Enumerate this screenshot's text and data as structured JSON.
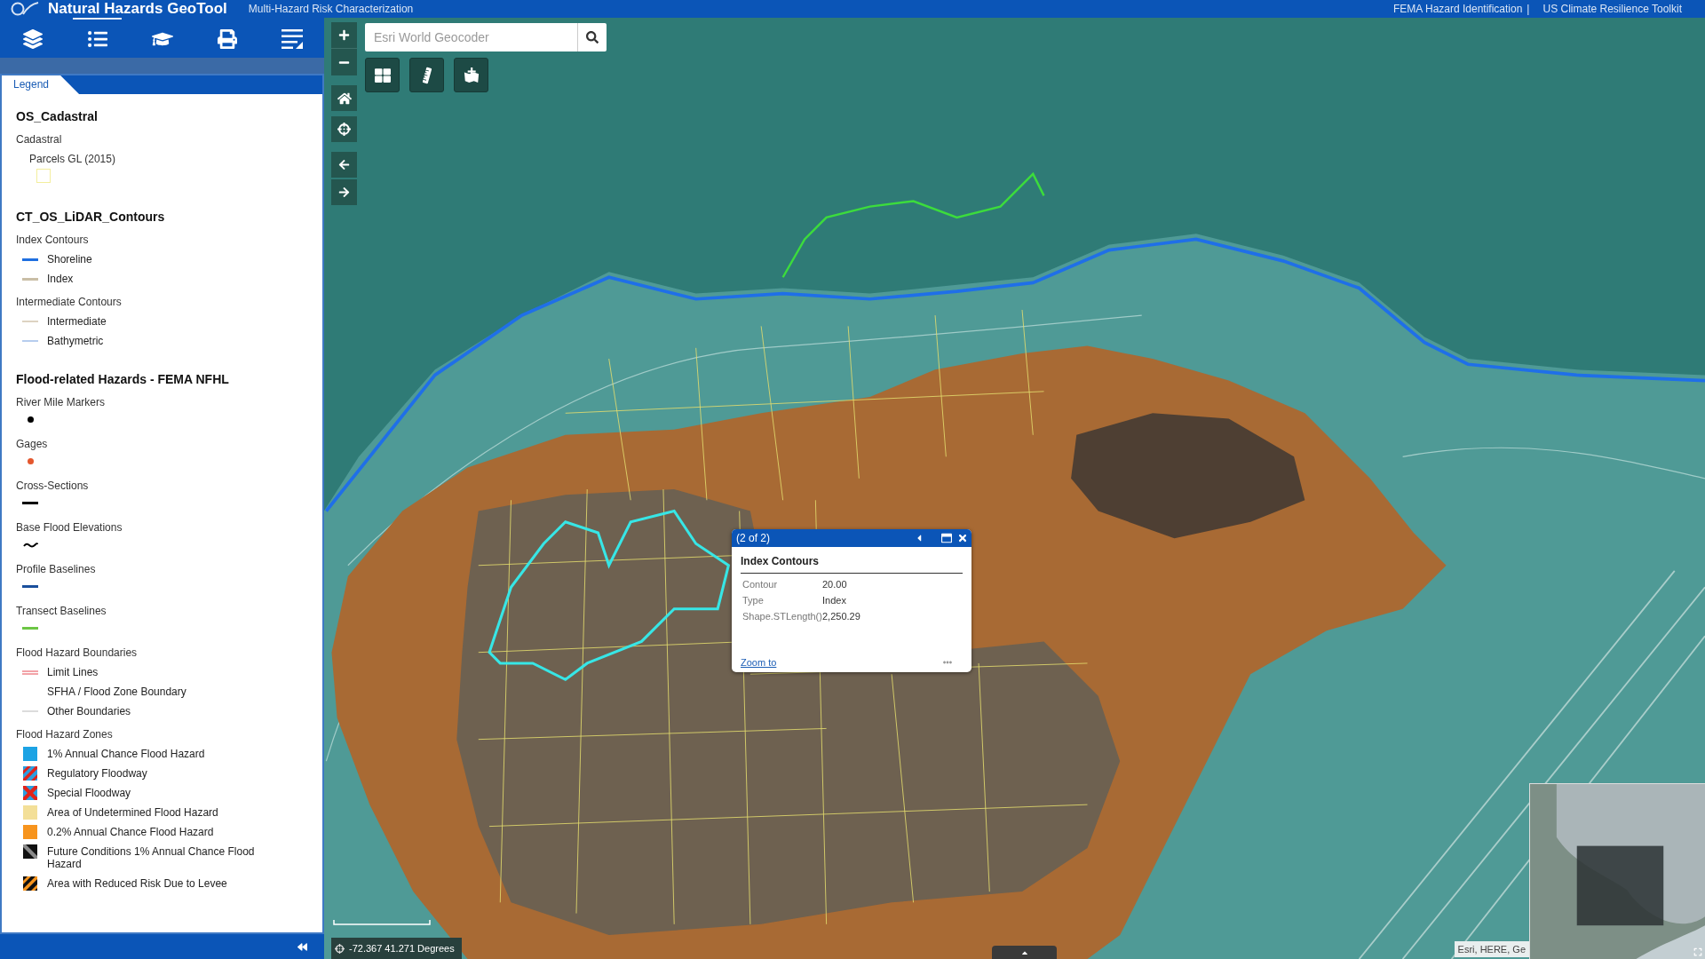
{
  "header": {
    "title": "Natural Hazards GeoTool",
    "subtitle": "Multi-Hazard Risk Characterization",
    "links": [
      "FEMA Hazard Identification",
      "US Climate Resilience Toolkit"
    ],
    "separator": "|"
  },
  "toolbar": [
    {
      "kind": "layers",
      "selected": false
    },
    {
      "kind": "legend",
      "selected": true
    },
    {
      "kind": "learn",
      "selected": false
    },
    {
      "kind": "print",
      "selected": false
    },
    {
      "kind": "menu",
      "selected": false
    }
  ],
  "panel": {
    "tab": {
      "label": "Legend",
      "selected": true
    },
    "legend": [
      {
        "layer": "OS_Cadastral",
        "sublayers": [
          {
            "name": "Cadastral",
            "children": [
              {
                "name": "Parcels GL (2015)",
                "symbol": {
                  "kind": "outline",
                  "color": "#f3ee9e"
                }
              }
            ]
          }
        ]
      },
      {
        "layer": "CT_OS_LiDAR_Contours",
        "sublayers": [
          {
            "name": "Index Contours",
            "classes": [
              {
                "label": "Shoreline",
                "symbol": {
                  "kind": "line",
                  "color": "#1f6fe0"
                }
              },
              {
                "label": "Index",
                "symbol": {
                  "kind": "line",
                  "color": "#c9bea6"
                }
              }
            ]
          },
          {
            "name": "Intermediate Contours",
            "classes": [
              {
                "label": "Intermediate",
                "symbol": {
                  "kind": "thin-line",
                  "color": "#ddd3c2"
                }
              },
              {
                "label": "Bathymetric",
                "symbol": {
                  "kind": "thin-line",
                  "color": "#b6cdee"
                }
              }
            ]
          }
        ]
      },
      {
        "layer": "Flood-related Hazards - FEMA NFHL",
        "sublayers": [
          {
            "name": "River Mile Markers",
            "symbol": {
              "kind": "dot",
              "color": "#000000"
            }
          },
          {
            "name": "Gages",
            "symbol": {
              "kind": "dot",
              "color": "#e4572e"
            }
          },
          {
            "name": "Cross-Sections",
            "symbol": {
              "kind": "line",
              "color": "#000000"
            }
          },
          {
            "name": "Base Flood Elevations",
            "symbol": {
              "kind": "wave",
              "color": "#000000"
            }
          },
          {
            "name": "Profile Baselines",
            "symbol": {
              "kind": "line",
              "color": "#1a4f9c"
            }
          },
          {
            "name": "Transect Baselines",
            "symbol": {
              "kind": "line",
              "color": "#6cc644"
            }
          },
          {
            "name": "Flood Hazard Boundaries",
            "classes": [
              {
                "label": "Limit Lines",
                "symbol": {
                  "kind": "double-line",
                  "color": "#f2a3a8"
                }
              },
              {
                "label": "SFHA / Flood Zone Boundary"
              },
              {
                "label": "Other Boundaries",
                "symbol": {
                  "kind": "thin-line",
                  "color": "#dcdcdc"
                }
              }
            ]
          },
          {
            "name": "Flood Hazard Zones",
            "classes": [
              {
                "label": "1% Annual Chance Flood Hazard",
                "symbol": {
                  "kind": "fill",
                  "color": "#1ca3e4"
                }
              },
              {
                "label": "Regulatory Floodway",
                "symbol": {
                  "kind": "stripes",
                  "fill": {
                    "color": "#2b9fe0"
                  },
                  "stripe": {
                    "color": "#e2231a"
                  }
                }
              },
              {
                "label": "Special Floodway",
                "symbol": {
                  "kind": "crosshatch",
                  "fill": {
                    "color": "#2b9fe0"
                  },
                  "stripe": {
                    "color": "#e2231a"
                  }
                }
              },
              {
                "label": "Area of Undetermined Flood Hazard",
                "symbol": {
                  "kind": "fill",
                  "color": "#f3df98"
                }
              },
              {
                "label": "0.2% Annual Chance Flood Hazard",
                "symbol": {
                  "kind": "fill",
                  "color": "#f7941d"
                }
              },
              {
                "label": "Future Conditions 1% Annual Chance Flood Hazard",
                "symbol": {
                  "kind": "back-stripes",
                  "fill": {
                    "color": "#111111"
                  },
                  "stripe": {
                    "color": "#8a8a8a"
                  }
                }
              },
              {
                "label": "Area with Reduced Risk Due to Levee",
                "symbol": {
                  "kind": "stripes",
                  "fill": {
                    "color": "#111111"
                  },
                  "stripe": {
                    "color": "#f7941d"
                  }
                }
              }
            ]
          }
        ]
      }
    ]
  },
  "search": {
    "placeholder": "Esri World Geocoder"
  },
  "popup": {
    "pager": "(2 of 2)",
    "title": "Index Contours",
    "fields": [
      {
        "name": "Contour",
        "value": "20.00"
      },
      {
        "name": "Type",
        "value": "Index"
      },
      {
        "name": "Shape.STLength()",
        "value": "2,250.29"
      }
    ],
    "link": "Zoom to"
  },
  "status": {
    "coordinates": "-72.367 41.271 Degrees",
    "attribution": "Esri, HERE, Ge"
  }
}
